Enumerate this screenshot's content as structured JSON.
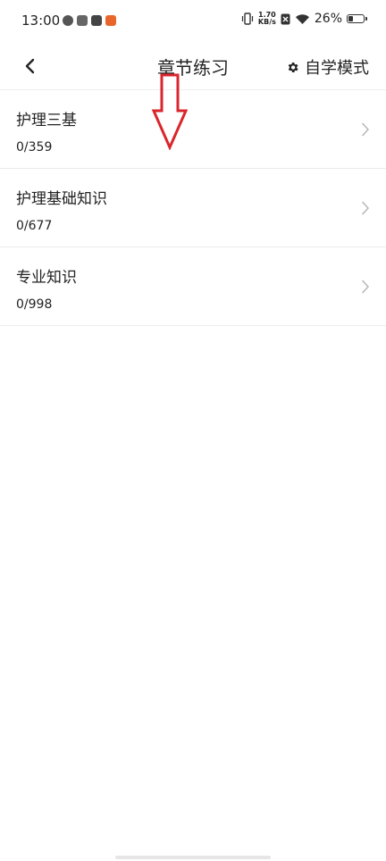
{
  "status_bar": {
    "time": "13:00",
    "net_speed_value": "1.70",
    "net_speed_unit": "KB/s",
    "battery": "26%",
    "battery_level": 0.26,
    "icons": [
      "app-notification-icon",
      "app-notification-icon",
      "app-notification-icon",
      "app-notification-icon",
      "vibrate-icon",
      "sim-off-icon",
      "wifi-icon",
      "battery-icon"
    ]
  },
  "header": {
    "back_icon": "back-arrow-icon",
    "title": "章节练习",
    "action_icon": "gear-icon",
    "action_label": "自学模式"
  },
  "chapters": [
    {
      "title": "护理三基",
      "progress": "0/359"
    },
    {
      "title": "护理基础知识",
      "progress": "0/677"
    },
    {
      "title": "专业知识",
      "progress": "0/998"
    }
  ],
  "colors": {
    "annotation_arrow": "#d9262c",
    "divider": "#ebebeb",
    "text": "#222222"
  }
}
